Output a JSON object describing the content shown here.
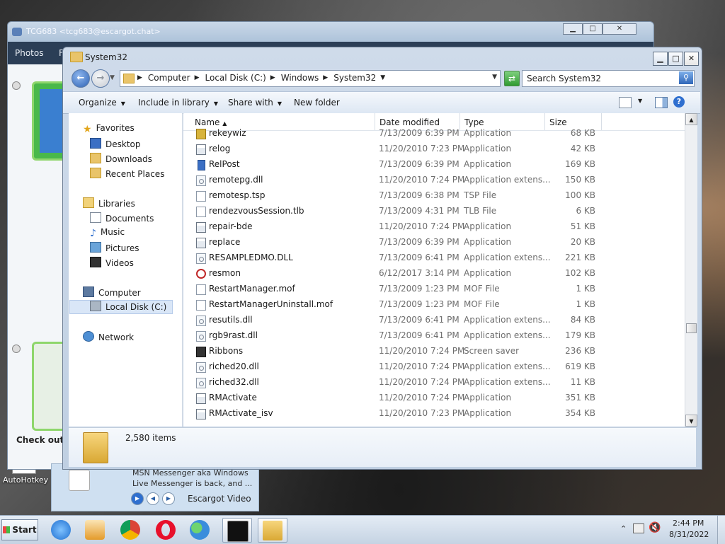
{
  "desktop": {
    "icons": [
      {
        "label": "AutoHotkey"
      }
    ]
  },
  "messenger": {
    "title": "TCG683 <tcg683@escargot.chat>",
    "menu": [
      "Photos",
      "F"
    ],
    "checkout_text": "Check out o",
    "min_label": "▁",
    "max_label": "□",
    "close_label": "✕"
  },
  "toast": {
    "text": "MSN Messenger aka Windows Live Messenger is back, and ...",
    "link": "Escargot Video"
  },
  "explorer": {
    "title": "System32",
    "breadcrumbs": [
      "Computer",
      "Local Disk (C:)",
      "Windows",
      "System32"
    ],
    "search_placeholder": "Search System32",
    "toolbar": {
      "organize": "Organize",
      "include": "Include in library",
      "share": "Share with",
      "newfolder": "New folder"
    },
    "nav": {
      "favorites": "Favorites",
      "desktop": "Desktop",
      "downloads": "Downloads",
      "recent": "Recent Places",
      "libraries": "Libraries",
      "documents": "Documents",
      "music": "Music",
      "pictures": "Pictures",
      "videos": "Videos",
      "computer": "Computer",
      "localdisk": "Local Disk (C:)",
      "network": "Network"
    },
    "columns": {
      "name": "Name",
      "date": "Date modified",
      "type": "Type",
      "size": "Size"
    },
    "files": [
      {
        "name": "rekeywiz",
        "date": "7/13/2009 6:39 PM",
        "type": "Application",
        "size": "68 KB",
        "icon": "key"
      },
      {
        "name": "relog",
        "date": "11/20/2010 7:23 PM",
        "type": "Application",
        "size": "42 KB",
        "icon": "app"
      },
      {
        "name": "RelPost",
        "date": "7/13/2009 6:39 PM",
        "type": "Application",
        "size": "169 KB",
        "icon": "rel"
      },
      {
        "name": "remotepg.dll",
        "date": "11/20/2010 7:24 PM",
        "type": "Application extens...",
        "size": "150 KB",
        "icon": "dll"
      },
      {
        "name": "remotesp.tsp",
        "date": "7/13/2009 6:38 PM",
        "type": "TSP File",
        "size": "100 KB",
        "icon": "txt"
      },
      {
        "name": "rendezvousSession.tlb",
        "date": "7/13/2009 4:31 PM",
        "type": "TLB File",
        "size": "6 KB",
        "icon": "txt"
      },
      {
        "name": "repair-bde",
        "date": "11/20/2010 7:24 PM",
        "type": "Application",
        "size": "51 KB",
        "icon": "app"
      },
      {
        "name": "replace",
        "date": "7/13/2009 6:39 PM",
        "type": "Application",
        "size": "20 KB",
        "icon": "app"
      },
      {
        "name": "RESAMPLEDMO.DLL",
        "date": "7/13/2009 6:41 PM",
        "type": "Application extens...",
        "size": "221 KB",
        "icon": "dll"
      },
      {
        "name": "resmon",
        "date": "6/12/2017 3:14 PM",
        "type": "Application",
        "size": "102 KB",
        "icon": "res"
      },
      {
        "name": "RestartManager.mof",
        "date": "7/13/2009 1:23 PM",
        "type": "MOF File",
        "size": "1 KB",
        "icon": "txt"
      },
      {
        "name": "RestartManagerUninstall.mof",
        "date": "7/13/2009 1:23 PM",
        "type": "MOF File",
        "size": "1 KB",
        "icon": "txt"
      },
      {
        "name": "resutils.dll",
        "date": "7/13/2009 6:41 PM",
        "type": "Application extens...",
        "size": "84 KB",
        "icon": "dll"
      },
      {
        "name": "rgb9rast.dll",
        "date": "7/13/2009 6:41 PM",
        "type": "Application extens...",
        "size": "179 KB",
        "icon": "dll"
      },
      {
        "name": "Ribbons",
        "date": "11/20/2010 7:24 PM",
        "type": "Screen saver",
        "size": "236 KB",
        "icon": "scr"
      },
      {
        "name": "riched20.dll",
        "date": "11/20/2010 7:24 PM",
        "type": "Application extens...",
        "size": "619 KB",
        "icon": "dll"
      },
      {
        "name": "riched32.dll",
        "date": "11/20/2010 7:24 PM",
        "type": "Application extens...",
        "size": "11 KB",
        "icon": "dll"
      },
      {
        "name": "RMActivate",
        "date": "11/20/2010 7:24 PM",
        "type": "Application",
        "size": "351 KB",
        "icon": "app"
      },
      {
        "name": "RMActivate_isv",
        "date": "11/20/2010 7:23 PM",
        "type": "Application",
        "size": "354 KB",
        "icon": "app"
      }
    ],
    "item_count": "2,580 items",
    "colors": {
      "accent": "#2f6fcf",
      "selection": "#d9e6f7"
    }
  },
  "taskbar": {
    "start": "Start",
    "time": "2:44 PM",
    "date": "8/31/2022"
  }
}
